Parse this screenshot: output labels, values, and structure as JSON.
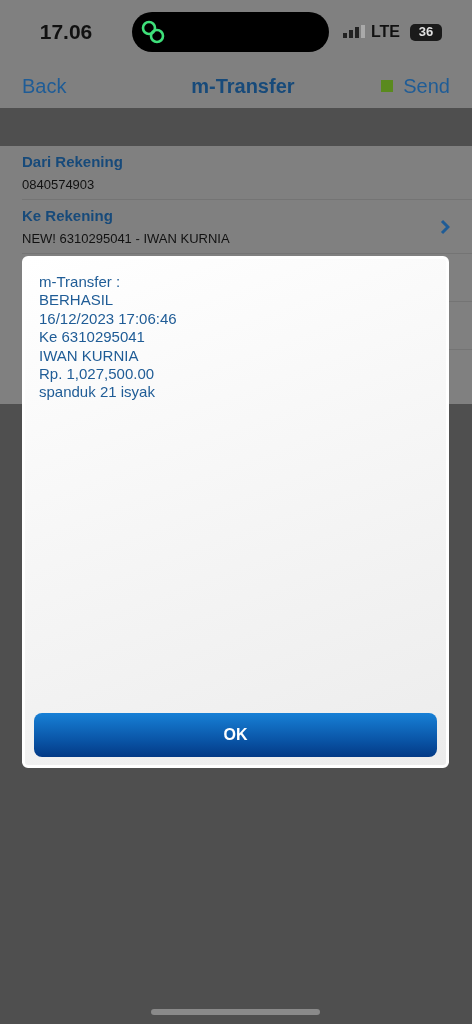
{
  "status_bar": {
    "time": "17.06",
    "network": "LTE",
    "battery": "36"
  },
  "nav": {
    "back": "Back",
    "title": "m-Transfer",
    "send": "Send"
  },
  "fields": [
    {
      "kind": "plain",
      "label": "Dari Rekening",
      "value": "0840574903"
    },
    {
      "kind": "chevron",
      "label": "Ke Rekening",
      "value": "NEW! 6310295041 - IWAN KURNIA"
    }
  ],
  "dialog": {
    "lines": [
      "m-Transfer :",
      "BERHASIL",
      "16/12/2023 17:06:46",
      "Ke 6310295041",
      "IWAN KURNIA",
      "Rp. 1,027,500.00",
      "spanduk 21 isyak"
    ],
    "button": "OK"
  }
}
